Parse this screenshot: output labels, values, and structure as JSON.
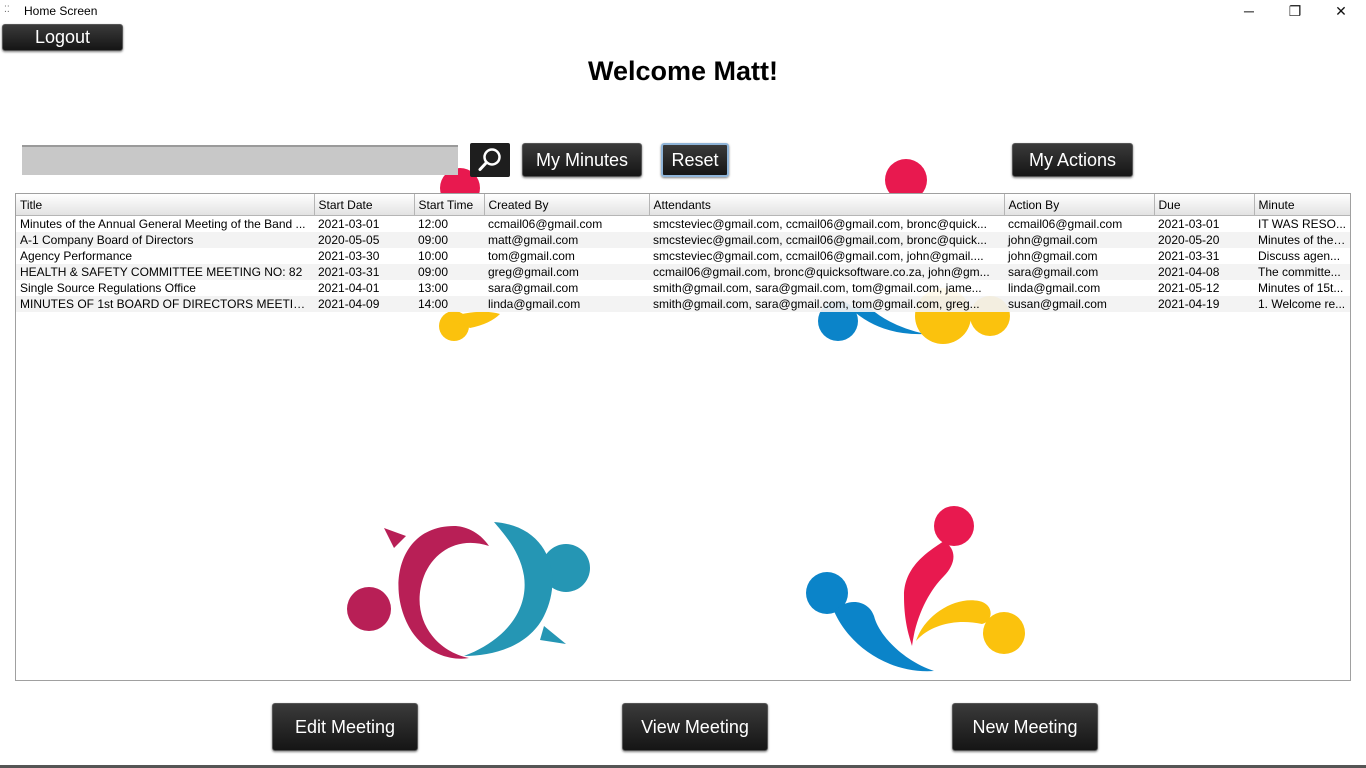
{
  "window": {
    "title": "Home Screen",
    "controls": {
      "minimize": "─",
      "maximize": "❐",
      "close": "✕"
    }
  },
  "header": {
    "logout_label": "Logout",
    "welcome": "Welcome Matt!"
  },
  "toolbar": {
    "search_value": "",
    "search_icon": "search-icon",
    "my_minutes_label": "My Minutes",
    "reset_label": "Reset",
    "my_actions_label": "My Actions"
  },
  "table": {
    "columns": [
      "Title",
      "Start Date",
      "Start Time",
      "Created By",
      "Attendants",
      "Action By",
      "Due",
      "Minute"
    ],
    "rows": [
      [
        "Minutes of the Annual General Meeting of the Band ...",
        "2021-03-01",
        "12:00",
        "ccmail06@gmail.com",
        "smcsteviec@gmail.com, ccmail06@gmail.com, bronc@quick...",
        "ccmail06@gmail.com",
        "2021-03-01",
        "IT WAS RESO..."
      ],
      [
        "A-1 Company Board of Directors",
        "2020-05-05",
        "09:00",
        "matt@gmail.com",
        "smcsteviec@gmail.com, ccmail06@gmail.com, bronc@quick...",
        "john@gmail.com",
        "2020-05-20",
        "Minutes of the ..."
      ],
      [
        "Agency Performance",
        "2021-03-30",
        "10:00",
        "tom@gmail.com",
        "smcsteviec@gmail.com, ccmail06@gmail.com, john@gmail....",
        "john@gmail.com",
        "2021-03-31",
        "Discuss agen..."
      ],
      [
        "HEALTH & SAFETY COMMITTEE MEETING NO: 82",
        "2021-03-31",
        "09:00",
        "greg@gmail.com",
        "ccmail06@gmail.com, bronc@quicksoftware.co.za, john@gm...",
        "sara@gmail.com",
        "2021-04-08",
        "The committe..."
      ],
      [
        "Single Source Regulations Office",
        "2021-04-01",
        "13:00",
        "sara@gmail.com",
        "smith@gmail.com, sara@gmail.com, tom@gmail.com, jame...",
        "linda@gmail.com",
        "2021-05-12",
        "Minutes of 15t..."
      ],
      [
        "MINUTES OF 1st BOARD OF DIRECTORS MEETIN...",
        "2021-04-09",
        "14:00",
        "linda@gmail.com",
        "smith@gmail.com, sara@gmail.com, tom@gmail.com, greg...",
        "susan@gmail.com",
        "2021-04-19",
        "1. Welcome re..."
      ]
    ]
  },
  "footer": {
    "edit_label": "Edit Meeting",
    "view_label": "View Meeting",
    "new_label": "New Meeting"
  },
  "colors": {
    "crimson": "#b81f56",
    "teal": "#2596b4",
    "red": "#e8194f",
    "blue": "#0b84c9",
    "yellow": "#fbc20d"
  }
}
